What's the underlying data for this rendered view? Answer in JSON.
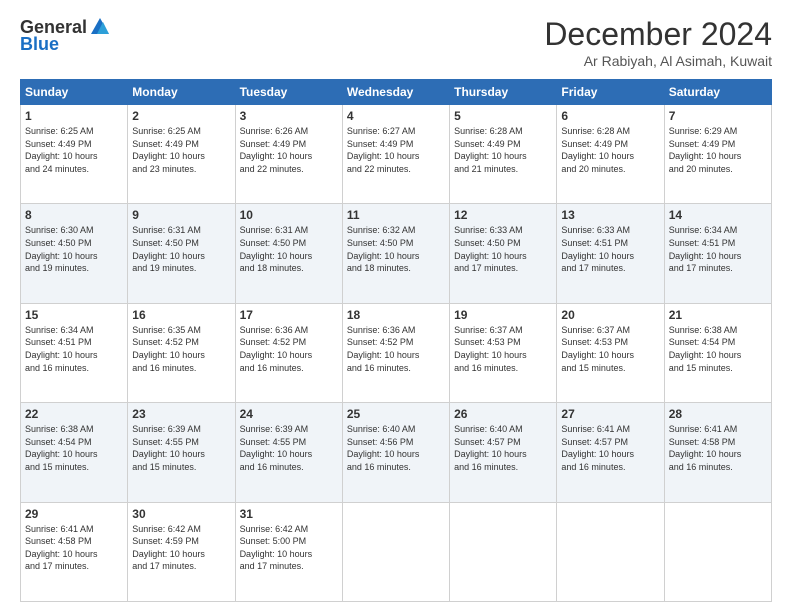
{
  "logo": {
    "general": "General",
    "blue": "Blue"
  },
  "header": {
    "month": "December 2024",
    "location": "Ar Rabiyah, Al Asimah, Kuwait"
  },
  "days_of_week": [
    "Sunday",
    "Monday",
    "Tuesday",
    "Wednesday",
    "Thursday",
    "Friday",
    "Saturday"
  ],
  "weeks": [
    [
      {
        "day": "1",
        "sunrise": "6:25 AM",
        "sunset": "4:49 PM",
        "daylight": "10 hours and 24 minutes."
      },
      {
        "day": "2",
        "sunrise": "6:25 AM",
        "sunset": "4:49 PM",
        "daylight": "10 hours and 23 minutes."
      },
      {
        "day": "3",
        "sunrise": "6:26 AM",
        "sunset": "4:49 PM",
        "daylight": "10 hours and 22 minutes."
      },
      {
        "day": "4",
        "sunrise": "6:27 AM",
        "sunset": "4:49 PM",
        "daylight": "10 hours and 22 minutes."
      },
      {
        "day": "5",
        "sunrise": "6:28 AM",
        "sunset": "4:49 PM",
        "daylight": "10 hours and 21 minutes."
      },
      {
        "day": "6",
        "sunrise": "6:28 AM",
        "sunset": "4:49 PM",
        "daylight": "10 hours and 20 minutes."
      },
      {
        "day": "7",
        "sunrise": "6:29 AM",
        "sunset": "4:49 PM",
        "daylight": "10 hours and 20 minutes."
      }
    ],
    [
      {
        "day": "8",
        "sunrise": "6:30 AM",
        "sunset": "4:50 PM",
        "daylight": "10 hours and 19 minutes."
      },
      {
        "day": "9",
        "sunrise": "6:31 AM",
        "sunset": "4:50 PM",
        "daylight": "10 hours and 19 minutes."
      },
      {
        "day": "10",
        "sunrise": "6:31 AM",
        "sunset": "4:50 PM",
        "daylight": "10 hours and 18 minutes."
      },
      {
        "day": "11",
        "sunrise": "6:32 AM",
        "sunset": "4:50 PM",
        "daylight": "10 hours and 18 minutes."
      },
      {
        "day": "12",
        "sunrise": "6:33 AM",
        "sunset": "4:50 PM",
        "daylight": "10 hours and 17 minutes."
      },
      {
        "day": "13",
        "sunrise": "6:33 AM",
        "sunset": "4:51 PM",
        "daylight": "10 hours and 17 minutes."
      },
      {
        "day": "14",
        "sunrise": "6:34 AM",
        "sunset": "4:51 PM",
        "daylight": "10 hours and 17 minutes."
      }
    ],
    [
      {
        "day": "15",
        "sunrise": "6:34 AM",
        "sunset": "4:51 PM",
        "daylight": "10 hours and 16 minutes."
      },
      {
        "day": "16",
        "sunrise": "6:35 AM",
        "sunset": "4:52 PM",
        "daylight": "10 hours and 16 minutes."
      },
      {
        "day": "17",
        "sunrise": "6:36 AM",
        "sunset": "4:52 PM",
        "daylight": "10 hours and 16 minutes."
      },
      {
        "day": "18",
        "sunrise": "6:36 AM",
        "sunset": "4:52 PM",
        "daylight": "10 hours and 16 minutes."
      },
      {
        "day": "19",
        "sunrise": "6:37 AM",
        "sunset": "4:53 PM",
        "daylight": "10 hours and 16 minutes."
      },
      {
        "day": "20",
        "sunrise": "6:37 AM",
        "sunset": "4:53 PM",
        "daylight": "10 hours and 15 minutes."
      },
      {
        "day": "21",
        "sunrise": "6:38 AM",
        "sunset": "4:54 PM",
        "daylight": "10 hours and 15 minutes."
      }
    ],
    [
      {
        "day": "22",
        "sunrise": "6:38 AM",
        "sunset": "4:54 PM",
        "daylight": "10 hours and 15 minutes."
      },
      {
        "day": "23",
        "sunrise": "6:39 AM",
        "sunset": "4:55 PM",
        "daylight": "10 hours and 15 minutes."
      },
      {
        "day": "24",
        "sunrise": "6:39 AM",
        "sunset": "4:55 PM",
        "daylight": "10 hours and 16 minutes."
      },
      {
        "day": "25",
        "sunrise": "6:40 AM",
        "sunset": "4:56 PM",
        "daylight": "10 hours and 16 minutes."
      },
      {
        "day": "26",
        "sunrise": "6:40 AM",
        "sunset": "4:57 PM",
        "daylight": "10 hours and 16 minutes."
      },
      {
        "day": "27",
        "sunrise": "6:41 AM",
        "sunset": "4:57 PM",
        "daylight": "10 hours and 16 minutes."
      },
      {
        "day": "28",
        "sunrise": "6:41 AM",
        "sunset": "4:58 PM",
        "daylight": "10 hours and 16 minutes."
      }
    ],
    [
      {
        "day": "29",
        "sunrise": "6:41 AM",
        "sunset": "4:58 PM",
        "daylight": "10 hours and 17 minutes."
      },
      {
        "day": "30",
        "sunrise": "6:42 AM",
        "sunset": "4:59 PM",
        "daylight": "10 hours and 17 minutes."
      },
      {
        "day": "31",
        "sunrise": "6:42 AM",
        "sunset": "5:00 PM",
        "daylight": "10 hours and 17 minutes."
      },
      null,
      null,
      null,
      null
    ]
  ],
  "labels": {
    "sunrise": "Sunrise:",
    "sunset": "Sunset:",
    "daylight": "Daylight:"
  }
}
